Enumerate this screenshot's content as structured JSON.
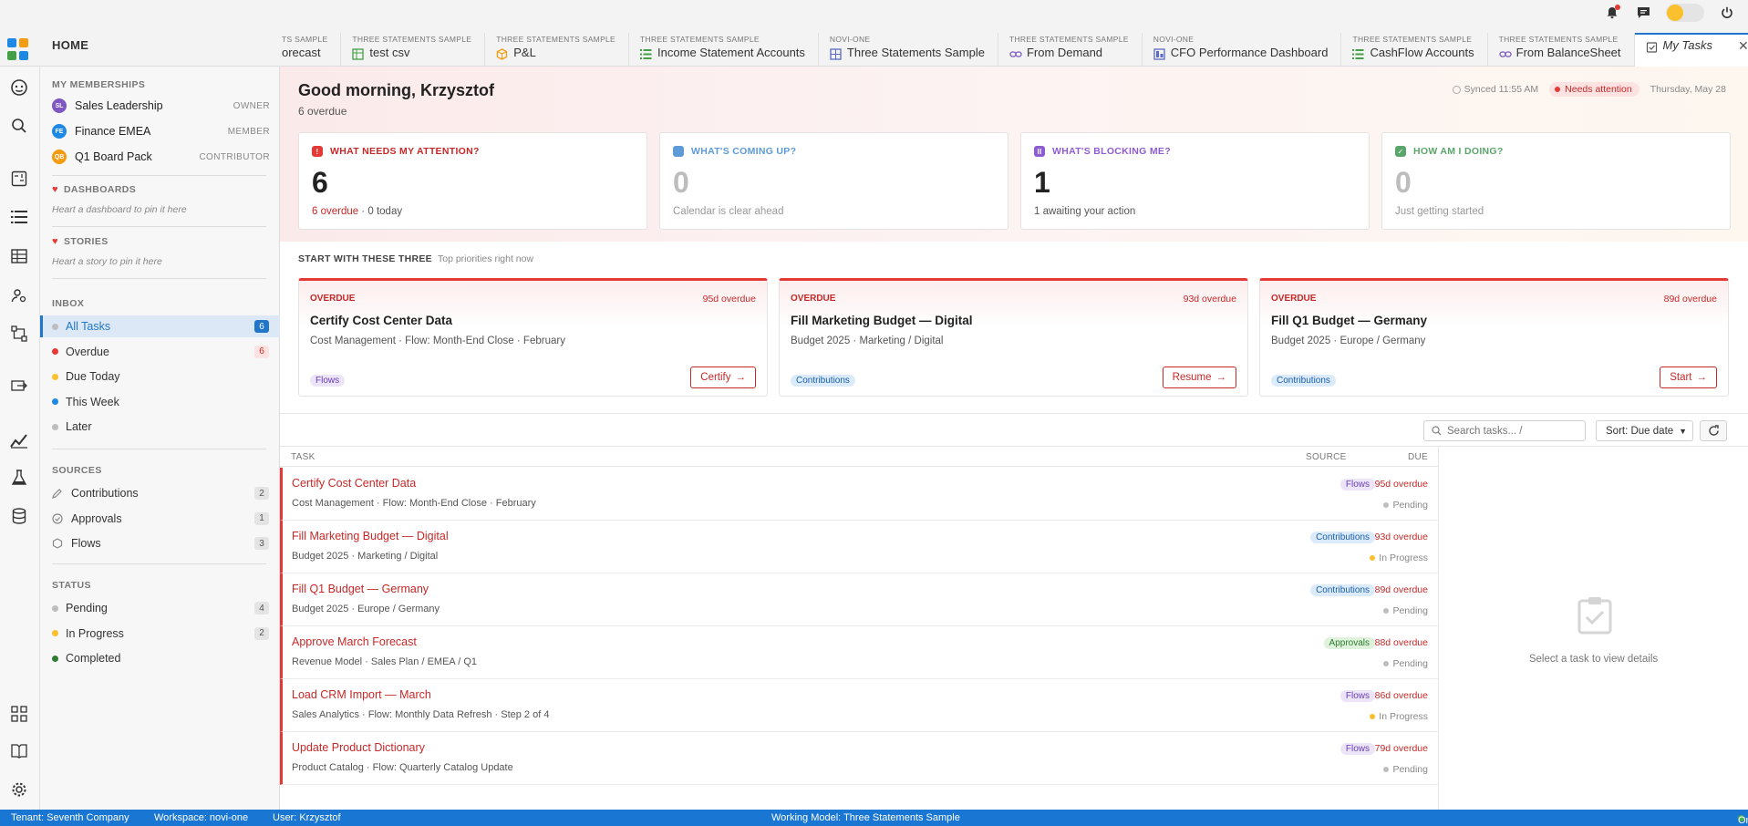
{
  "home": {
    "label": "HOME"
  },
  "tabs": [
    {
      "sub": "TS SAMPLE",
      "label": "orecast",
      "icon": "none"
    },
    {
      "sub": "THREE STATEMENTS SAMPLE",
      "label": "test csv",
      "icon": "sheet-icon",
      "color": "#43a047"
    },
    {
      "sub": "THREE STATEMENTS SAMPLE",
      "label": "P&L",
      "icon": "cube-icon",
      "color": "#f39c12"
    },
    {
      "sub": "THREE STATEMENTS SAMPLE",
      "label": "Income Statement Accounts",
      "icon": "list-icon",
      "color": "#43a047"
    },
    {
      "sub": "NOVI-ONE",
      "label": "Three Statements Sample",
      "icon": "grid-icon",
      "color": "#5c6bc0"
    },
    {
      "sub": "THREE STATEMENTS SAMPLE",
      "label": "From Demand",
      "icon": "link-icon",
      "color": "#7e57c2"
    },
    {
      "sub": "NOVI-ONE",
      "label": "CFO Performance Dashboard",
      "icon": "dashboard-icon",
      "color": "#5c6bc0"
    },
    {
      "sub": "THREE STATEMENTS SAMPLE",
      "label": "CashFlow Accounts",
      "icon": "list-icon",
      "color": "#43a047"
    },
    {
      "sub": "THREE STATEMENTS SAMPLE",
      "label": "From BalanceSheet",
      "icon": "link-icon",
      "color": "#7e57c2"
    },
    {
      "sub": "",
      "label": "My Tasks",
      "icon": "task-icon",
      "color": "#555",
      "active": true
    }
  ],
  "sidebar": {
    "memberships_title": "MY MEMBERSHIPS",
    "memberships": [
      {
        "initials": "SL",
        "name": "Sales Leadership",
        "role": "OWNER",
        "color": "#7e57c2"
      },
      {
        "initials": "FE",
        "name": "Finance EMEA",
        "role": "MEMBER",
        "color": "#1e88e5"
      },
      {
        "initials": "QB",
        "name": "Q1 Board Pack",
        "role": "CONTRIBUTOR",
        "color": "#f39c12"
      }
    ],
    "dashboards_title": "DASHBOARDS",
    "dashboards_hint": "Heart a dashboard to pin it here",
    "stories_title": "STORIES",
    "stories_hint": "Heart a story to pin it here",
    "inbox_title": "INBOX",
    "inbox": [
      {
        "label": "All Tasks",
        "count": "6",
        "dot": "#bdbdbd",
        "countStyle": "blue",
        "active": true
      },
      {
        "label": "Overdue",
        "count": "6",
        "dot": "#e53935",
        "countStyle": "red"
      },
      {
        "label": "Due Today",
        "count": "",
        "dot": "#fbc02d"
      },
      {
        "label": "This Week",
        "count": "",
        "dot": "#1e88e5"
      },
      {
        "label": "Later",
        "count": "",
        "dot": "#bdbdbd"
      }
    ],
    "sources_title": "SOURCES",
    "sources": [
      {
        "label": "Contributions",
        "count": "2",
        "icon": "pencil-icon"
      },
      {
        "label": "Approvals",
        "count": "1",
        "icon": "check-circle-icon"
      },
      {
        "label": "Flows",
        "count": "3",
        "icon": "hexagon-icon"
      }
    ],
    "status_title": "STATUS",
    "status": [
      {
        "label": "Pending",
        "count": "4",
        "dot": "#bdbdbd"
      },
      {
        "label": "In Progress",
        "count": "2",
        "dot": "#fbc02d"
      },
      {
        "label": "Completed",
        "count": "",
        "dot": "#2e7d32"
      }
    ]
  },
  "main": {
    "greeting": "Good morning, Krzysztof",
    "greeting_sub": "6 overdue",
    "synced": "Synced 11:55 AM",
    "attention_badge": "Needs attention",
    "date": "Thursday, May 28",
    "kpis": [
      {
        "title": "WHAT NEEDS MY ATTENTION?",
        "value": "6",
        "desc_a": "6 overdue",
        "desc_b": " · 0 today",
        "titleColor": "#c62828",
        "valueColor": "#222",
        "iconColor": "#e53935",
        "iconGlyph": "!"
      },
      {
        "title": "WHAT'S COMING UP?",
        "value": "0",
        "desc_a": "",
        "desc_b": "Calendar is clear ahead",
        "titleColor": "#5c9ad8",
        "valueColor": "#bdbdbd",
        "iconColor": "#5c9ad8",
        "iconGlyph": ""
      },
      {
        "title": "WHAT'S BLOCKING ME?",
        "value": "1",
        "desc_a": "",
        "desc_b": "1 awaiting your action",
        "titleColor": "#8e5cd1",
        "valueColor": "#222",
        "iconColor": "#8e5cd1",
        "iconGlyph": "II"
      },
      {
        "title": "HOW AM I DOING?",
        "value": "0",
        "desc_a": "",
        "desc_b": "Just getting started",
        "titleColor": "#5aa569",
        "valueColor": "#bdbdbd",
        "iconColor": "#5aa569",
        "iconGlyph": "✓"
      }
    ],
    "starts_title": "START WITH THESE THREE",
    "starts_sub": "Top priorities right now",
    "priority_cards": [
      {
        "label": "OVERDUE",
        "days": "95d overdue",
        "title": "Certify Cost Center Data",
        "sub": "Cost Management · Flow: Month-End Close · February",
        "chip": "Flows",
        "chipType": "flows",
        "button": "Certify"
      },
      {
        "label": "OVERDUE",
        "days": "93d overdue",
        "title": "Fill Marketing Budget — Digital",
        "sub": "Budget 2025 · Marketing / Digital",
        "chip": "Contributions",
        "chipType": "contrib",
        "button": "Resume"
      },
      {
        "label": "OVERDUE",
        "days": "89d overdue",
        "title": "Fill Q1 Budget — Germany",
        "sub": "Budget 2025 · Europe / Germany",
        "chip": "Contributions",
        "chipType": "contrib",
        "button": "Start"
      }
    ],
    "search_placeholder": "Search tasks... /",
    "sort_label": "Sort: Due date",
    "list_headers": {
      "task": "TASK",
      "source": "SOURCE",
      "due": "DUE"
    },
    "tasks": [
      {
        "title": "Certify Cost Center Data",
        "sub": "Cost Management · Flow: Month-End Close · February",
        "chip": "Flows",
        "chipType": "flows",
        "due": "95d overdue",
        "status": "Pending",
        "statusColor": "#bdbdbd"
      },
      {
        "title": "Fill Marketing Budget — Digital",
        "sub": "Budget 2025 · Marketing / Digital",
        "chip": "Contributions",
        "chipType": "contrib",
        "due": "93d overdue",
        "status": "In Progress",
        "statusColor": "#fbc02d"
      },
      {
        "title": "Fill Q1 Budget — Germany",
        "sub": "Budget 2025 · Europe / Germany",
        "chip": "Contributions",
        "chipType": "contrib",
        "due": "89d overdue",
        "status": "Pending",
        "statusColor": "#bdbdbd"
      },
      {
        "title": "Approve March Forecast",
        "sub": "Revenue Model · Sales Plan / EMEA / Q1",
        "chip": "Approvals",
        "chipType": "approvals",
        "due": "88d overdue",
        "status": "Pending",
        "statusColor": "#bdbdbd"
      },
      {
        "title": "Load CRM Import — March",
        "sub": "Sales Analytics · Flow: Monthly Data Refresh · Step 2 of 4",
        "chip": "Flows",
        "chipType": "flows",
        "due": "86d overdue",
        "status": "In Progress",
        "statusColor": "#fbc02d"
      },
      {
        "title": "Update Product Dictionary",
        "sub": "Product Catalog · Flow: Quarterly Catalog Update",
        "chip": "Flows",
        "chipType": "flows",
        "due": "79d overdue",
        "status": "Pending",
        "statusColor": "#bdbdbd"
      }
    ],
    "detail_empty": "Select a task to view details"
  },
  "statusbar": {
    "tenant": "Tenant: Seventh Company",
    "workspace": "Workspace: novi-one",
    "user": "User: Krzysztof",
    "model": "Working Model: Three Statements Sample",
    "online": "Online"
  }
}
